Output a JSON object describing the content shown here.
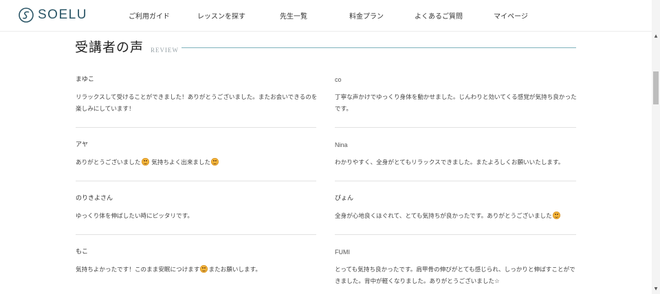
{
  "brand": {
    "name": "SOELU"
  },
  "nav": [
    "ご利用ガイド",
    "レッスンを探す",
    "先生一覧",
    "料金プラン",
    "よくあるご質問",
    "マイページ"
  ],
  "section": {
    "title": "受講者の声",
    "subtitle": "REVIEW"
  },
  "reviews": [
    {
      "name": "まゆこ",
      "text": "リラックスして受けることができました！ありがとうございました。またお会いできるのを楽しみにしています！"
    },
    {
      "name": "co",
      "text": "丁寧な声かけでゆっくり身体を動かせました。じんわりと効いてくる感覚が気持ち良かったです。"
    },
    {
      "name": "アヤ",
      "text_a": "ありがとうございました",
      "text_b": " 気持ちよく出来ました"
    },
    {
      "name": "Nina",
      "text": "わかりやすく、全身がとてもリラックスできました。またよろしくお願いいたします。"
    },
    {
      "name": "のりきよさん",
      "text": "ゆっくり体を伸ばしたい時にピッタリです。"
    },
    {
      "name": "ぴょん",
      "text_a": "全身が心地良くほぐれて、とても気持ちが良かったです。ありがとうございました"
    },
    {
      "name": "もこ",
      "text_a": "気持ちよかったです！このまま安眠につけます",
      "text_b": "またお願いします。"
    },
    {
      "name": "FUMI",
      "text": "とっても気持ち良かったです。肩甲骨の伸びがとても感じられ、しっかりと伸ばすことができました。背中が軽くなりました。ありがとうございました☆"
    }
  ],
  "icons": {
    "logo": "soelu-logo-icon",
    "emoji": "smiling-face-emoji",
    "scroll_up": "scroll-up-arrow-icon",
    "scroll_down": "scroll-down-arrow-icon"
  },
  "colors": {
    "brand": "#2a5566",
    "accent_line": "#7fb3bd",
    "emoji": "#f6b93b"
  }
}
